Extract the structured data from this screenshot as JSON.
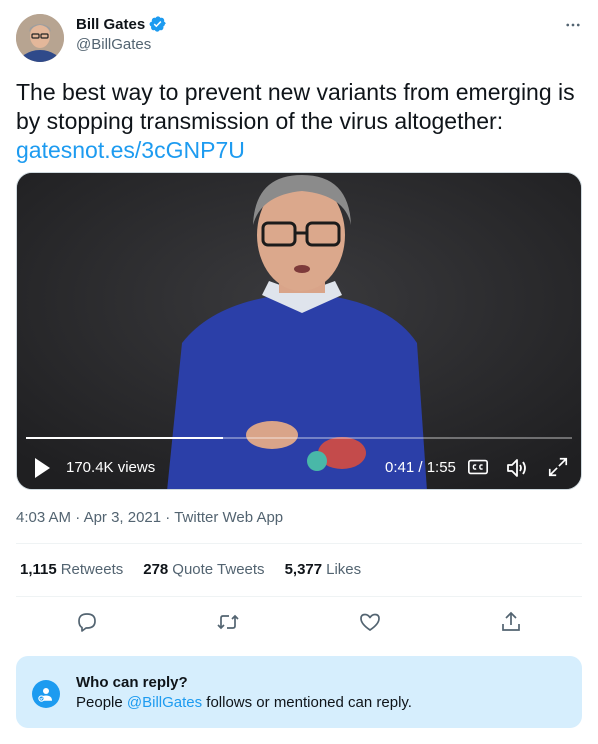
{
  "author": {
    "name": "Bill Gates",
    "handle": "@BillGates",
    "verified": true
  },
  "more_icon": "more-horizontal-icon",
  "tweet": {
    "text": "The best way to prevent new variants from emerging is by stopping transmission of the virus altogether:",
    "link": "gatesnot.es/3cGNP7U"
  },
  "video": {
    "views": "170.4K views",
    "time": "0:41 / 1:55",
    "progress_fraction": 0.36,
    "icons": [
      "play-icon",
      "closed-captions-icon",
      "volume-icon",
      "fullscreen-icon"
    ]
  },
  "meta": {
    "time": "4:03 AM",
    "sep1": " · ",
    "date": "Apr 3, 2021",
    "sep2": " · ",
    "source": "Twitter Web App"
  },
  "stats": {
    "retweets_count": "1,115",
    "retweets_label": "Retweets",
    "quotes_count": "278",
    "quotes_label": "Quote Tweets",
    "likes_count": "5,377",
    "likes_label": "Likes"
  },
  "actions": [
    "reply-icon",
    "retweet-icon",
    "like-icon",
    "share-icon"
  ],
  "reply_restriction": {
    "title": "Who can reply?",
    "prefix": "People ",
    "mention": "@BillGates",
    "suffix": " follows or mentioned can reply."
  },
  "colors": {
    "accent": "#1d9bf0",
    "text": "#0f1419",
    "secondary": "#536471",
    "reply_box_bg": "#d6eefd"
  }
}
